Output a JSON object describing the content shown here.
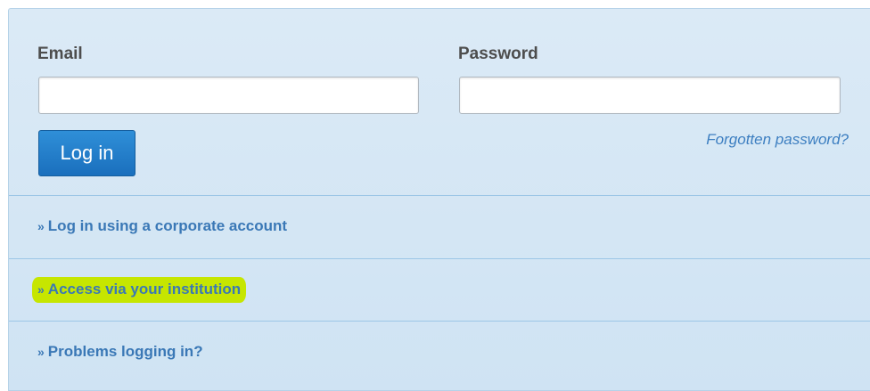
{
  "login_form": {
    "email_label": "Email",
    "email_value": "",
    "email_placeholder": "",
    "password_label": "Password",
    "password_value": "",
    "password_placeholder": "",
    "login_button": "Log in",
    "forgot_password": "Forgotten password?"
  },
  "links": [
    {
      "marker": "»",
      "label": "Log in using a corporate account"
    },
    {
      "marker": "»",
      "label": "Access via your institution",
      "highlighted": true
    },
    {
      "marker": "»",
      "label": "Problems logging in?"
    }
  ],
  "colors": {
    "panel_bg": "#d5e6f5",
    "button_bg": "#1f7cc9",
    "link": "#3a78b6",
    "highlight": "#c6e600"
  }
}
